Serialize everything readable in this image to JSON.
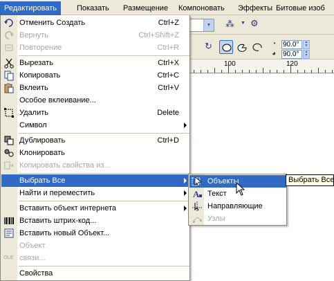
{
  "menubar": {
    "items": [
      {
        "label": "Редактировать",
        "active": true
      },
      {
        "label": "Показать"
      },
      {
        "label": "Размещение"
      },
      {
        "label": "Компоновать"
      },
      {
        "label": "Эффекты"
      },
      {
        "label": "Битовые изоб"
      }
    ]
  },
  "toolbar": {
    "angle_top": "90.0",
    "angle_bottom": "90.0",
    "angle_top_unit": "°",
    "angle_bottom_unit": "°"
  },
  "ruler": {
    "labels": [
      "100",
      "120"
    ]
  },
  "edit_menu": {
    "items": [
      {
        "label": "Отменить Создать",
        "shortcut": "Ctrl+Z",
        "icon": "undo-icon"
      },
      {
        "label": "Вернуть",
        "shortcut": "Ctrl+Shift+Z",
        "icon": "redo-icon",
        "disabled": true
      },
      {
        "label": "Повторение",
        "shortcut": "Ctrl+R",
        "icon": "repeat-icon",
        "disabled": true
      },
      {
        "label": "Вырезать",
        "shortcut": "Ctrl+X",
        "icon": "scissors-icon"
      },
      {
        "label": "Копировать",
        "shortcut": "Ctrl+C",
        "icon": "copy-icon"
      },
      {
        "label": "Вклеить",
        "shortcut": "Ctrl+V",
        "icon": "paste-icon"
      },
      {
        "label": "Особое вклеивание...",
        "shortcut": "",
        "icon": ""
      },
      {
        "label": "Удалить",
        "shortcut": "Delete",
        "icon": "delete-icon"
      },
      {
        "label": "Символ",
        "shortcut": "",
        "icon": "",
        "submenu": true
      },
      {
        "label": "Дублировать",
        "shortcut": "Ctrl+D",
        "icon": "duplicate-icon"
      },
      {
        "label": "Клонировать",
        "shortcut": "",
        "icon": "clone-icon"
      },
      {
        "label": "Копировать свойства из...",
        "shortcut": "",
        "icon": "copy-properties-icon",
        "disabled": true
      },
      {
        "label": "Выбрать Все",
        "shortcut": "",
        "icon": "",
        "submenu": true,
        "highlight": true
      },
      {
        "label": "Найти и переместить",
        "shortcut": "",
        "icon": "",
        "submenu": true
      },
      {
        "label": "Вставить объект интернета",
        "shortcut": "",
        "icon": "",
        "submenu": true
      },
      {
        "label": "Вставить штрих-код...",
        "shortcut": "",
        "icon": "barcode-icon"
      },
      {
        "label": "Вставить новый Объект...",
        "shortcut": "",
        "icon": "insert-object-icon"
      },
      {
        "label": "Объект",
        "shortcut": "",
        "icon": "",
        "disabled": true
      },
      {
        "label": "связи...",
        "shortcut": "",
        "icon": "ole-links-icon",
        "disabled": true
      },
      {
        "label": "Свойства",
        "shortcut": "",
        "icon": ""
      }
    ]
  },
  "select_all_submenu": {
    "items": [
      {
        "label": "Объекты",
        "icon": "select-objects-icon",
        "highlight": true
      },
      {
        "label": "Текст",
        "icon": "select-text-icon"
      },
      {
        "label": "Направляющие",
        "icon": "select-guidelines-icon"
      },
      {
        "label": "Узлы",
        "icon": "select-nodes-icon",
        "disabled": true
      }
    ]
  },
  "tooltip": {
    "text": "Выбрать Все"
  },
  "colors": {
    "menu_highlight": "#316ac5",
    "menu_gutter": "#ece9d8",
    "disabled_text": "#a7a6aa",
    "tooltip_bg": "#ffffe1"
  }
}
